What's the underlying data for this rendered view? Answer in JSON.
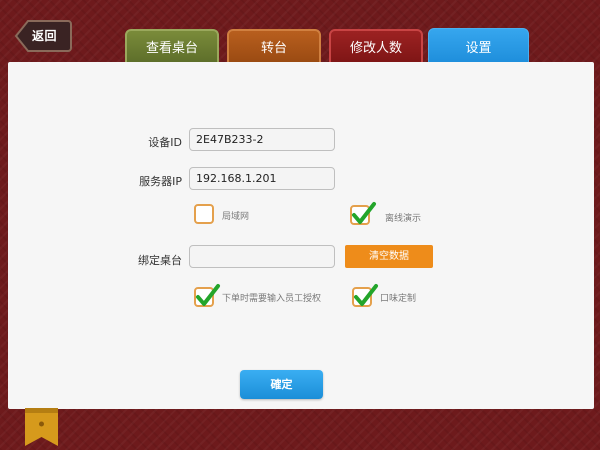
{
  "header": {
    "back_label": "返回",
    "tabs": [
      {
        "label": "查看桌台"
      },
      {
        "label": "转台"
      },
      {
        "label": "修改人数"
      },
      {
        "label": "设置"
      }
    ]
  },
  "form": {
    "device_id": {
      "label": "设备ID",
      "value": "2E47B233-2"
    },
    "server_ip": {
      "label": "服务器IP",
      "value": "192.168.1.201"
    },
    "lan": {
      "label": "局域网",
      "checked": false
    },
    "offline_demo": {
      "label": "离线演示",
      "checked": true
    },
    "bind_table": {
      "label": "绑定桌台",
      "value": ""
    },
    "clear_data_label": "清空数据",
    "require_auth": {
      "label": "下单时需要输入员工授权",
      "checked": true
    },
    "taste_custom": {
      "label": "口味定制",
      "checked": true
    },
    "confirm_label": "確定"
  },
  "icons": {
    "checkmark": "checkmark-icon",
    "back_arrow": "back-arrow-icon",
    "bookmark": "bookmark-icon"
  },
  "colors": {
    "background": "#6e1a1c",
    "active_tab": "#2196e6",
    "checkbox_border": "#e4a04c",
    "check": "#23a52b",
    "clear_button": "#ee8c1a",
    "confirm_button": "#2196e6"
  }
}
